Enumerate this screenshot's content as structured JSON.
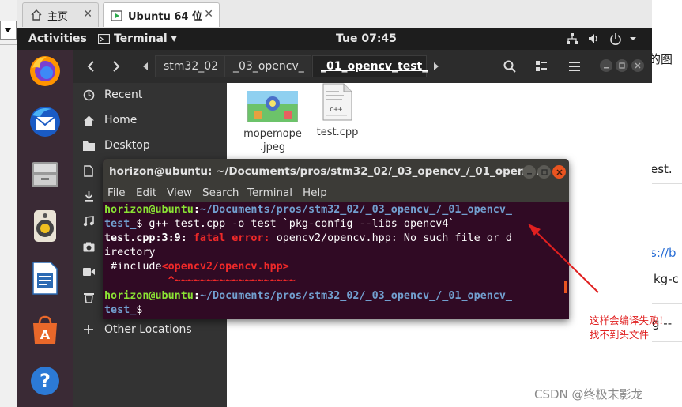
{
  "host": {
    "tabs": [
      {
        "label": "主页"
      },
      {
        "label": "Ubuntu 64 位"
      }
    ],
    "close_glyph": "✕",
    "right_fragments": [
      "的图",
      "est.",
      "s://b",
      "kg-c",
      "g --"
    ]
  },
  "topbar": {
    "activities": "Activities",
    "app_menu": "Terminal ▾",
    "clock": "Tue 07:45"
  },
  "dock": {
    "apps": [
      {
        "name": "firefox",
        "icon": "firefox-icon"
      },
      {
        "name": "thunderbird",
        "icon": "thunderbird-icon"
      },
      {
        "name": "files",
        "icon": "files-icon"
      },
      {
        "name": "rhythmbox",
        "icon": "rhythmbox-icon"
      },
      {
        "name": "libreoffice-writer",
        "icon": "writer-icon"
      },
      {
        "name": "software",
        "icon": "software-icon"
      },
      {
        "name": "help",
        "icon": "help-icon"
      }
    ]
  },
  "files": {
    "path": [
      "stm32_02",
      "_03_opencv_",
      "_01_opencv_test_"
    ],
    "sidebar": [
      {
        "label": "Recent",
        "icon": "clock-icon"
      },
      {
        "label": "Home",
        "icon": "home-icon"
      },
      {
        "label": "Desktop",
        "icon": "desktop-icon"
      },
      {
        "label": "",
        "icon": "documents-icon"
      },
      {
        "label": "",
        "icon": "downloads-icon"
      },
      {
        "label": "",
        "icon": "music-icon"
      },
      {
        "label": "",
        "icon": "pictures-icon"
      },
      {
        "label": "",
        "icon": "videos-icon"
      },
      {
        "label": "",
        "icon": "trash-icon"
      },
      {
        "label": "Other Locations",
        "icon": "plus-icon"
      }
    ],
    "items": [
      {
        "name": "mopemope\n.jpeg",
        "icon": "image-file-icon"
      },
      {
        "name": "test.cpp",
        "icon": "cpp-file-icon",
        "badge": "c++"
      }
    ]
  },
  "terminal": {
    "title": "horizon@ubuntu: ~/Documents/pros/stm32_02/_03_opencv_/_01_openc...",
    "menu": [
      "File",
      "Edit",
      "View",
      "Search",
      "Terminal",
      "Help"
    ],
    "lines": {
      "l1_user": "horizon@ubuntu",
      "l1_colon": ":",
      "l1_path": "~/Documents/pros/stm32_02/_03_opencv_/_01_opencv_",
      "l2_path": "test_",
      "l2_cmd": "$ g++ test.cpp -o test `pkg-config --libs opencv4`",
      "l3_loc": "test.cpp:3:9: ",
      "l3_err": "fatal error: ",
      "l3_msg": "opencv2/opencv.hpp: No such file or d",
      "l4": "irectory",
      "l5_a": " #include",
      "l5_b": "<opencv2/opencv.hpp>",
      "l6": "          ^~~~~~~~~~~~~~~~~~~~",
      "l7_user": "horizon@ubuntu",
      "l7_colon": ":",
      "l7_path": "~/Documents/pros/stm32_02/_03_opencv_/_01_opencv_",
      "l8_path": "test_",
      "l8_prompt": "$ "
    }
  },
  "annotation": {
    "text": "这样会编译失败！找不到头文件",
    "color": "#e02020"
  },
  "watermark": "CSDN @终极末影龙"
}
